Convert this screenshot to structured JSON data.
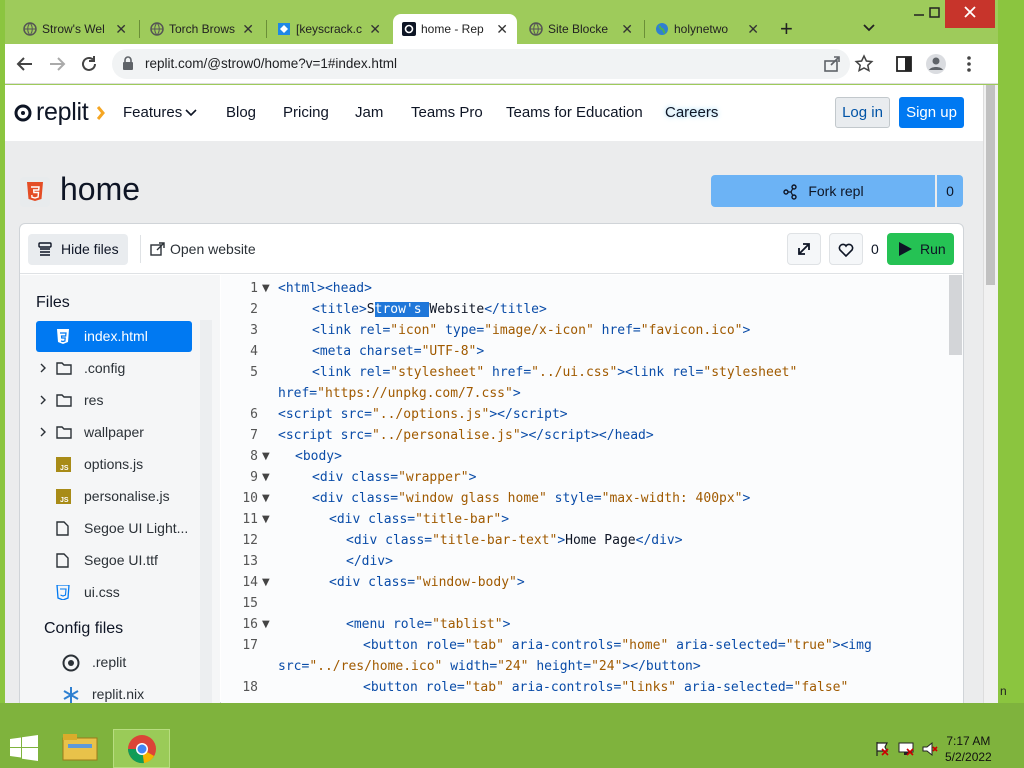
{
  "browser": {
    "tabs": [
      {
        "title": "Strow's Wel",
        "active": false
      },
      {
        "title": "Torch Brows",
        "active": false
      },
      {
        "title": "[keyscrack.c",
        "active": false
      },
      {
        "title": "home - Rep",
        "active": true
      },
      {
        "title": "Site Blocke",
        "active": false
      },
      {
        "title": "holynetwo",
        "active": false
      }
    ],
    "new_tab": "+",
    "close_tab": "✕",
    "url": "replit.com/@strow0/home?v=1#index.html"
  },
  "nav": {
    "logo": "replit",
    "items": [
      "Features",
      "Blog",
      "Pricing",
      "Jam",
      "Teams Pro",
      "Teams for Education",
      "Careers"
    ],
    "login": "Log in",
    "signup": "Sign up"
  },
  "repl": {
    "title": "home",
    "fork_label": "Fork repl",
    "fork_count": "0",
    "hide_files": "Hide files",
    "open_website": "Open website",
    "like_count": "0",
    "run": "Run"
  },
  "files": {
    "heading": "Files",
    "items": [
      {
        "name": "index.html",
        "type": "html",
        "active": true
      },
      {
        "name": ".config",
        "type": "folder"
      },
      {
        "name": "res",
        "type": "folder"
      },
      {
        "name": "wallpaper",
        "type": "folder"
      },
      {
        "name": "options.js",
        "type": "js"
      },
      {
        "name": "personalise.js",
        "type": "js"
      },
      {
        "name": "Segoe UI Light...",
        "type": "file"
      },
      {
        "name": "Segoe UI.ttf",
        "type": "file"
      },
      {
        "name": "ui.css",
        "type": "css"
      }
    ],
    "config_heading": "Config files",
    "config_items": [
      {
        "name": ".replit",
        "type": "replit"
      },
      {
        "name": "replit.nix",
        "type": "nix"
      }
    ]
  },
  "editor": {
    "line_numbers": [
      "1",
      "2",
      "3",
      "4",
      "5",
      "6",
      "7",
      "8",
      "9",
      "10",
      "11",
      "12",
      "13",
      "14",
      "15",
      "16",
      "17",
      "18"
    ]
  },
  "taskbar": {
    "time": "7:17 AM",
    "date": "5/2/2022"
  },
  "colors": {
    "accent": "#0079f2",
    "run_green": "#25c254",
    "desktop_green": "#8bc53f"
  }
}
